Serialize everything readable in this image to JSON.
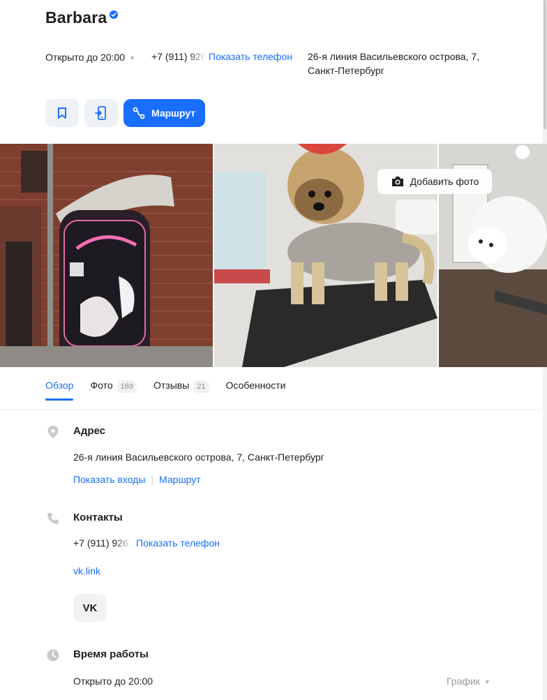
{
  "header": {
    "title": "Barbara",
    "hours": "Открыто до 20:00",
    "phone_partial": "+7 (911) 926",
    "show_phone": "Показать телефон",
    "address": "26-я линия Васильевского острова, 7, Санкт-Петербург"
  },
  "actions": {
    "route_label": "Маршрут"
  },
  "gallery": {
    "add_photo_label": "Добавить фото"
  },
  "tabs": [
    {
      "label": "Обзор",
      "count": ""
    },
    {
      "label": "Фото",
      "count": "169"
    },
    {
      "label": "Отзывы",
      "count": "21"
    },
    {
      "label": "Особенности",
      "count": ""
    }
  ],
  "address_section": {
    "title": "Адрес",
    "text": "26-я линия Васильевского острова, 7, Санкт-Петербург",
    "show_entrances": "Показать входы",
    "route": "Маршрут"
  },
  "contacts_section": {
    "title": "Контакты",
    "phone_partial": "+7 (911) 926-",
    "show_phone": "Показать телефон",
    "site": "vk.link",
    "vk_label": "VK"
  },
  "hours_section": {
    "title": "Время работы",
    "status": "Открыто до 20:00",
    "schedule": "График"
  },
  "colors": {
    "accent": "#196dff",
    "button_bg": "#eef1f6"
  }
}
